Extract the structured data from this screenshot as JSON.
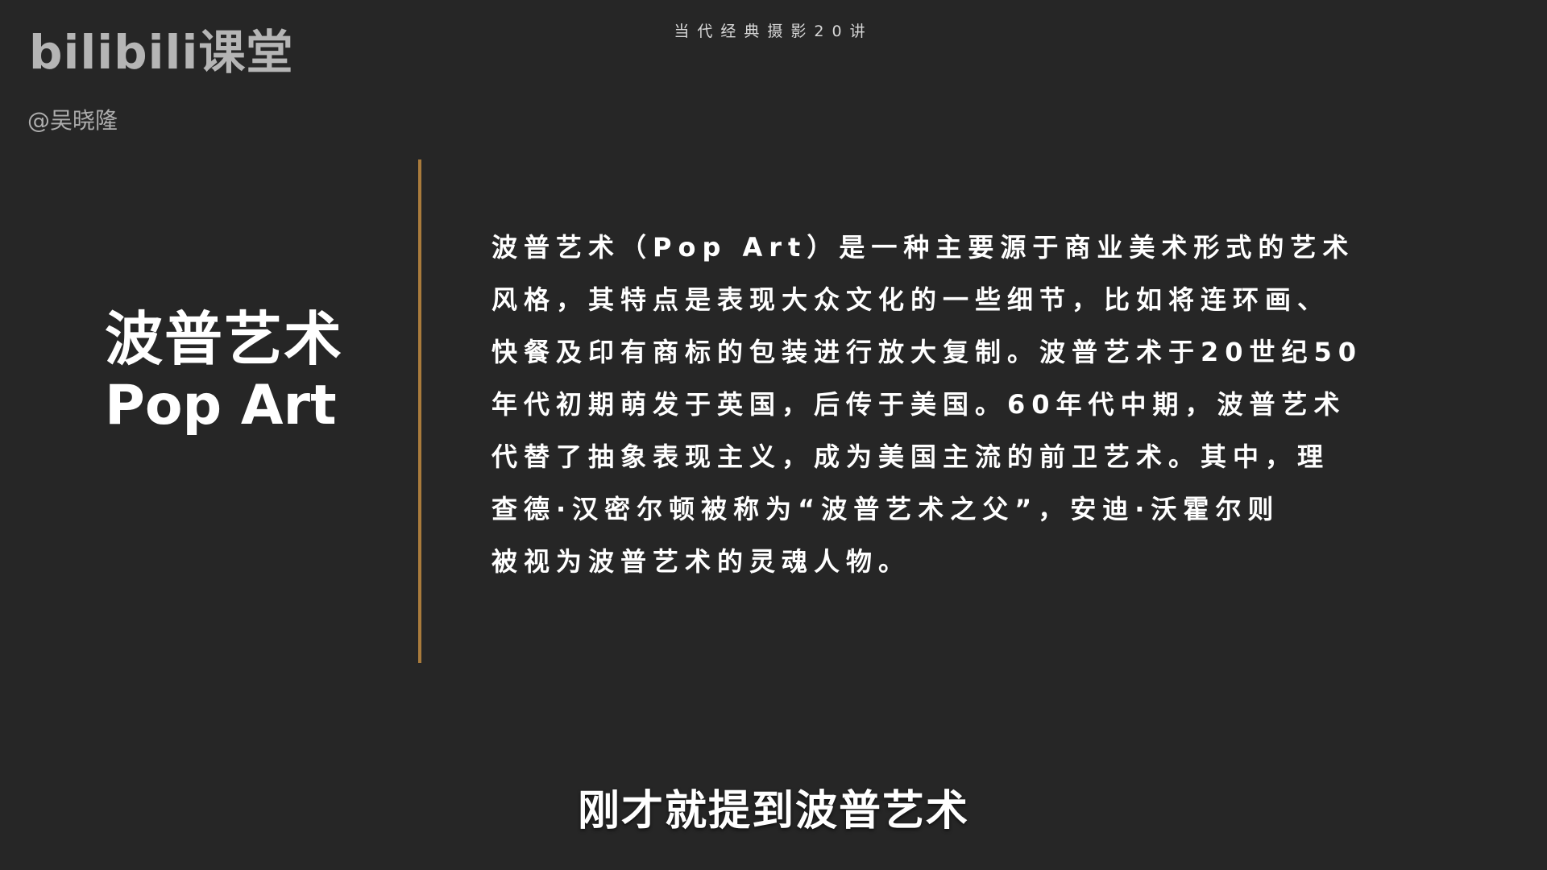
{
  "watermark": {
    "logo_text": "bilibili课堂",
    "author": "@吴晓隆"
  },
  "header": {
    "series_title": "当代经典摄影20讲"
  },
  "slide": {
    "title_zh": "波普艺术",
    "title_en": "Pop Art",
    "divider_color": "#a97b3c",
    "body_lines": [
      "波普艺术（Pop Art）是一种主要源于商业美术形式的艺术",
      "风格，其特点是表现大众文化的一些细节，比如将连环画、",
      "快餐及印有商标的包装进行放大复制。波普艺术于20世纪50",
      "年代初期萌发于英国，后传于美国。60年代中期，波普艺术",
      "代替了抽象表现主义，成为美国主流的前卫艺术。其中，理",
      "查德·汉密尔顿被称为“波普艺术之父”，安迪·沃霍尔则",
      "被视为波普艺术的灵魂人物。"
    ]
  },
  "caption": {
    "text": "刚才就提到波普艺术"
  },
  "colors": {
    "background": "#262626",
    "text": "#ffffff",
    "accent": "#a97b3c"
  }
}
